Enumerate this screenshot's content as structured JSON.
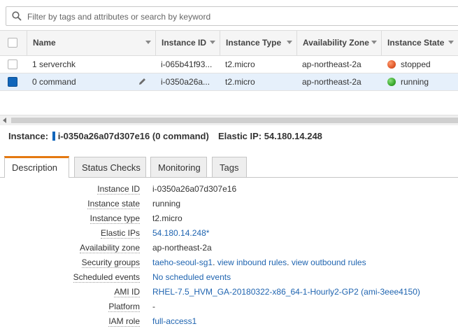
{
  "search": {
    "placeholder": "Filter by tags and attributes or search by keyword"
  },
  "table": {
    "columns": [
      "Name",
      "Instance ID",
      "Instance Type",
      "Availability Zone",
      "Instance State"
    ],
    "rows": [
      {
        "name": "1 serverchk",
        "instance_id": "i-065b41f93...",
        "instance_type": "t2.micro",
        "zone": "ap-northeast-2a",
        "state": "stopped",
        "state_color": "#e05a2b",
        "selected": false
      },
      {
        "name": "0 command",
        "instance_id": "i-0350a26a...",
        "instance_type": "t2.micro",
        "zone": "ap-northeast-2a",
        "state": "running",
        "state_color": "#3aa82d",
        "selected": true
      }
    ]
  },
  "summary": {
    "instance_label": "Instance:",
    "instance_value": "i-0350a26a07d307e16 (0 command)",
    "elastic_ip_label": "Elastic IP:",
    "elastic_ip_value": "54.180.14.248"
  },
  "tabs": [
    "Description",
    "Status Checks",
    "Monitoring",
    "Tags"
  ],
  "active_tab": "Description",
  "description": {
    "instance_id": {
      "label": "Instance ID",
      "value": "i-0350a26a07d307e16"
    },
    "instance_state": {
      "label": "Instance state",
      "value": "running"
    },
    "instance_type": {
      "label": "Instance type",
      "value": "t2.micro"
    },
    "elastic_ips": {
      "label": "Elastic IPs",
      "value": "54.180.14.248*"
    },
    "availability_zone": {
      "label": "Availability zone",
      "value": "ap-northeast-2a"
    },
    "security_groups": {
      "label": "Security groups",
      "group": "taeho-seoul-sg1",
      "sep": ".",
      "inbound": "view inbound rules",
      "outbound": "view outbound rules"
    },
    "scheduled_events": {
      "label": "Scheduled events",
      "value": "No scheduled events"
    },
    "ami_id": {
      "label": "AMI ID",
      "value": "RHEL-7.5_HVM_GA-20180322-x86_64-1-Hourly2-GP2 (ami-3eee4150)"
    },
    "platform": {
      "label": "Platform",
      "value": "-"
    },
    "iam_role": {
      "label": "IAM role",
      "value": "full-access1"
    }
  },
  "colors": {
    "accent_tab": "#e47911",
    "link": "#1f64b0",
    "selected_row": "#e6f0fb",
    "checkbox_selected": "#1166bb"
  }
}
